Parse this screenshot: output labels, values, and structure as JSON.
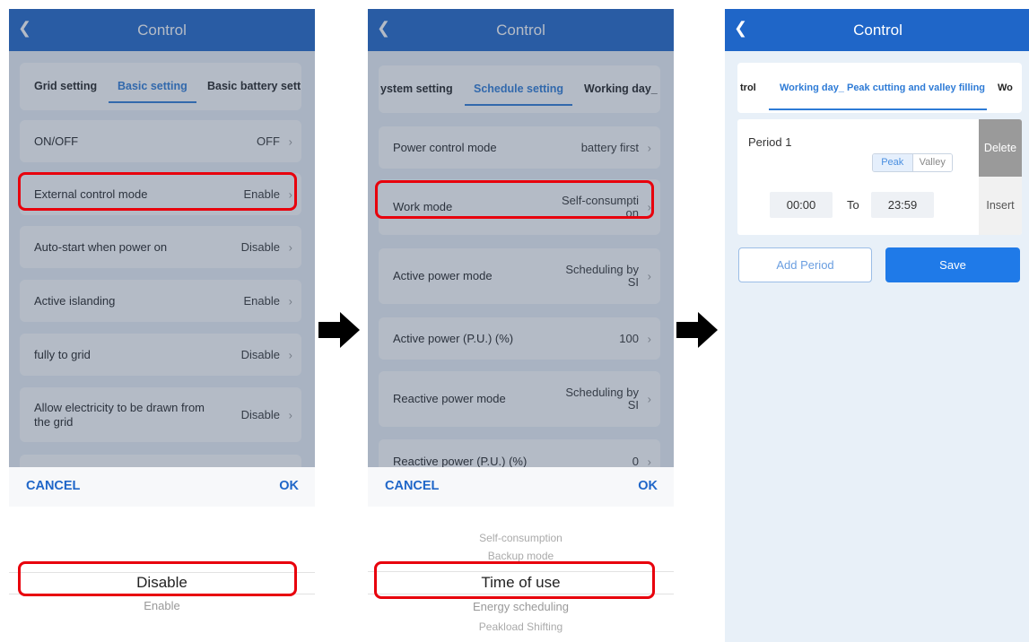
{
  "panel1": {
    "title": "Control",
    "tabs": [
      "Grid setting",
      "Basic setting",
      "Basic battery setti"
    ],
    "rows": [
      {
        "label": "ON/OFF",
        "value": "OFF"
      },
      {
        "label": "External control mode",
        "value": "Enable"
      },
      {
        "label": "Auto-start when power on",
        "value": "Disable"
      },
      {
        "label": "Active islanding",
        "value": "Enable"
      },
      {
        "label": "fully to grid",
        "value": "Disable"
      },
      {
        "label": "Allow electricity to be drawn from the grid",
        "value": "Disable"
      }
    ],
    "cancel": "CANCEL",
    "ok": "OK",
    "picker": {
      "selected": "Disable",
      "options": [
        "Enable"
      ]
    }
  },
  "panel2": {
    "title": "Control",
    "tabs": [
      "ystem setting",
      "Schedule setting",
      "Working day_"
    ],
    "rows": [
      {
        "label": "Power control mode",
        "value": "battery first"
      },
      {
        "label": "Work mode",
        "value": "Self-consumption"
      },
      {
        "label": "Active power mode",
        "value": "Scheduling by SI"
      },
      {
        "label": "Active power (P.U.)  (%)",
        "value": "100"
      },
      {
        "label": "Reactive power mode",
        "value": "Scheduling by SI"
      },
      {
        "label": "Reactive power (P.U.)  (%)",
        "value": "0"
      }
    ],
    "cancel": "CANCEL",
    "ok": "OK",
    "picker": {
      "above": [
        "Self-consumption",
        "Backup mode"
      ],
      "selected": "Time of use",
      "below": [
        "Energy scheduling",
        "Peakload Shifting"
      ]
    }
  },
  "panel3": {
    "title": "Control",
    "tabs": [
      "trol",
      "Working day_ Peak cutting and valley filling",
      "Wo"
    ],
    "period_label": "Period 1",
    "peak": "Peak",
    "valley": "Valley",
    "start_time": "00:00",
    "to": "To",
    "end_time": "23:59",
    "delete": "Delete",
    "insert": "Insert",
    "add_period": "Add Period",
    "save": "Save"
  },
  "colors": {
    "header": "#1f66c8",
    "accent": "#2e7bd6",
    "highlight": "#e8000c"
  }
}
